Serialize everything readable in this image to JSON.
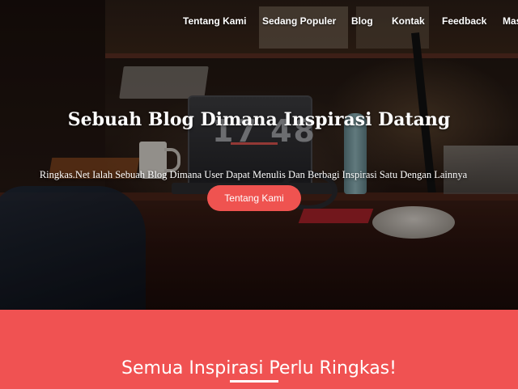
{
  "nav": {
    "items": [
      {
        "label": "Tentang Kami"
      },
      {
        "label": "Sedang Populer"
      },
      {
        "label": "Blog"
      },
      {
        "label": "Kontak"
      },
      {
        "label": "Feedback"
      },
      {
        "label": "Mas"
      }
    ]
  },
  "hero": {
    "title": "Sebuah Blog Dimana Inspirasi Datang",
    "subtitle": "Ringkas.Net Ialah Sebuah Blog Dimana User Dapat Menulis Dan Berbagi Inspirasi Satu Dengan Lainnya",
    "button_label": "Tentang Kami",
    "photo_clock_text": "17 48"
  },
  "intro": {
    "title": "Semua Inspirasi Perlu Ringkas!"
  },
  "colors": {
    "accent": "#f05252",
    "button": "#ef5350",
    "text_light": "#ffffff"
  }
}
